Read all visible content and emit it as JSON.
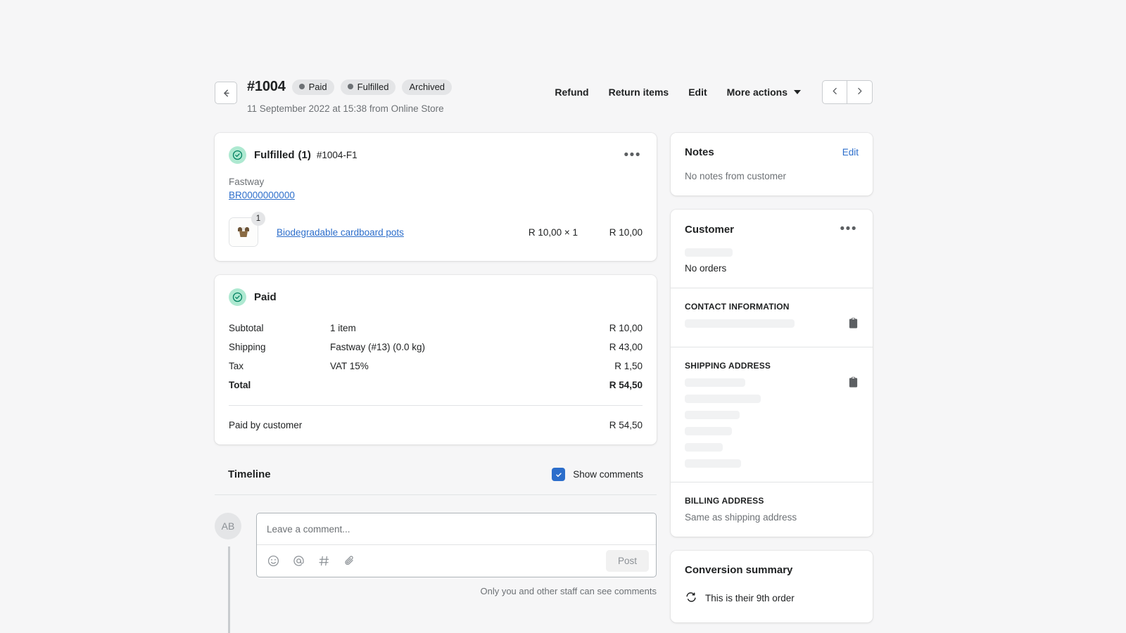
{
  "header": {
    "back_icon": "arrow-left-icon",
    "order_number": "#1004",
    "badges": [
      {
        "label": "Paid",
        "dot": true
      },
      {
        "label": "Fulfilled",
        "dot": true
      },
      {
        "label": "Archived",
        "dot": false
      }
    ],
    "subtitle": "11 September 2022 at 15:38 from Online Store",
    "actions": [
      {
        "label": "Refund",
        "name": "refund-button"
      },
      {
        "label": "Return items",
        "name": "return-items-button"
      },
      {
        "label": "Edit",
        "name": "edit-button"
      }
    ],
    "more_actions_label": "More actions",
    "prev_icon": "chevron-left-icon",
    "next_icon": "chevron-right-icon"
  },
  "fulfillment": {
    "status_icon": "check-circle-icon",
    "status": "Fulfilled",
    "count": "(1)",
    "reference": "#1004-F1",
    "kebab_icon": "ellipsis-icon",
    "carrier": "Fastway",
    "tracking_number": "BR0000000000",
    "line_item": {
      "quantity": "1",
      "title": "Biodegradable cardboard pots",
      "unit_price": "R 10,00 × 1",
      "total": "R 10,00"
    }
  },
  "payment": {
    "status_icon": "check-circle-icon",
    "status": "Paid",
    "rows": [
      {
        "label": "Subtotal",
        "desc": "1 item",
        "amount": "R 10,00"
      },
      {
        "label": "Shipping",
        "desc": "Fastway (#13) (0.0 kg)",
        "amount": "R 43,00"
      },
      {
        "label": "Tax",
        "desc": "VAT 15%",
        "amount": "R 1,50"
      },
      {
        "label": "Total",
        "desc": "",
        "amount": "R 54,50"
      }
    ],
    "footer_label": "Paid by customer",
    "footer_amount": "R 54,50"
  },
  "timeline": {
    "title": "Timeline",
    "show_comments_label": "Show comments",
    "show_comments_checked": true,
    "avatar_initials": "AB",
    "comment_placeholder": "Leave a comment...",
    "comment_value": "",
    "toolbar_icons": [
      "emoji-icon",
      "mention-icon",
      "hashtag-icon",
      "attachment-icon"
    ],
    "post_label": "Post",
    "privacy_note": "Only you and other staff can see comments"
  },
  "notes": {
    "title": "Notes",
    "edit_label": "Edit",
    "empty_text": "No notes from customer"
  },
  "customer": {
    "title": "Customer",
    "kebab_icon": "ellipsis-icon",
    "orders_text": "No orders",
    "contact_heading": "CONTACT INFORMATION",
    "shipping_heading": "SHIPPING ADDRESS",
    "billing_heading": "BILLING ADDRESS",
    "billing_text": "Same as shipping address",
    "copy_icon": "clipboard-icon"
  },
  "conversion": {
    "title": "Conversion summary",
    "icon": "repeat-order-icon",
    "text": "This is their 9th order"
  },
  "colors": {
    "page_bg": "#f6f6f7",
    "accent_link": "#2c6ecb",
    "success": "#008060",
    "success_bg": "#aee9d1",
    "text": "#202223",
    "subdued": "#6d7175"
  }
}
